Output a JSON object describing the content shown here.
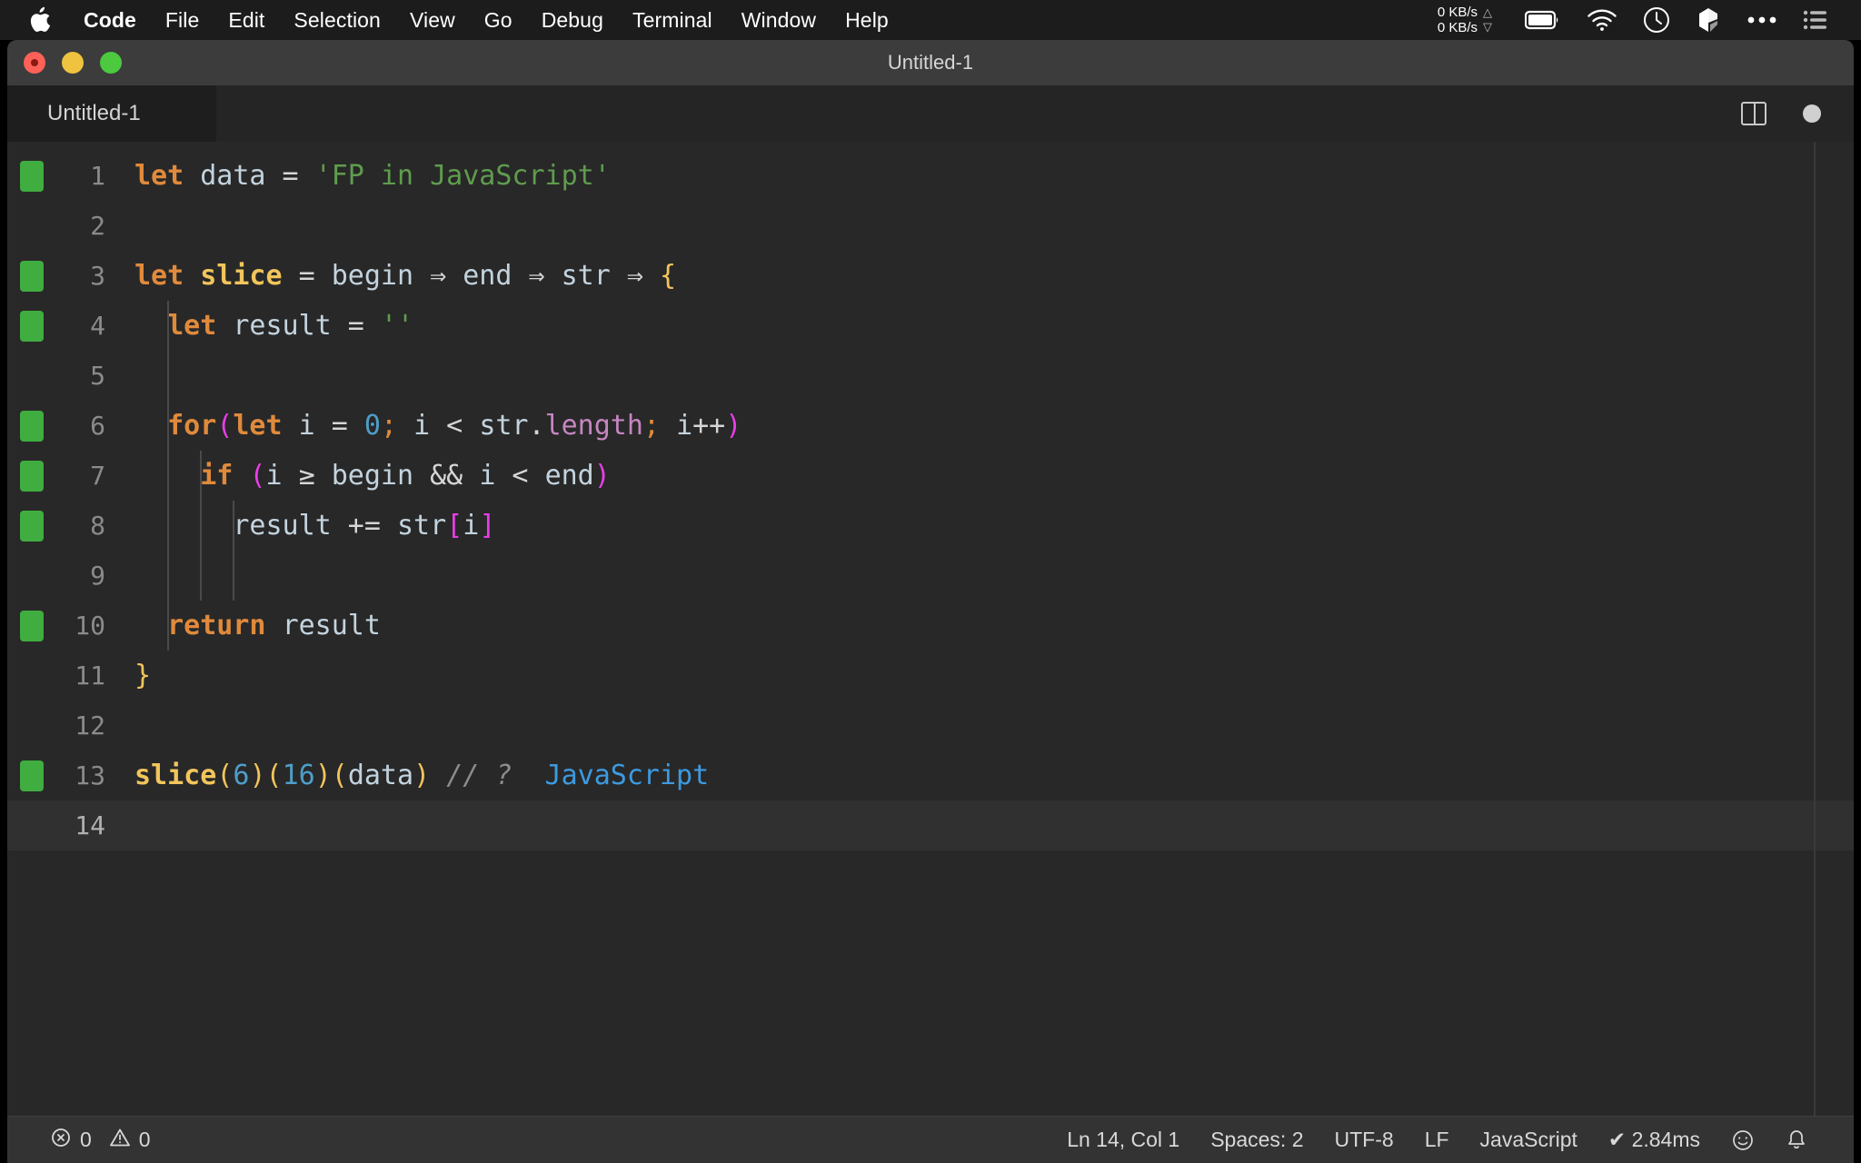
{
  "menubar": {
    "apple_icon": "apple-logo-icon",
    "items": [
      {
        "label": "Code",
        "bold": true
      },
      {
        "label": "File",
        "bold": false
      },
      {
        "label": "Edit",
        "bold": false
      },
      {
        "label": "Selection",
        "bold": false
      },
      {
        "label": "View",
        "bold": false
      },
      {
        "label": "Go",
        "bold": false
      },
      {
        "label": "Debug",
        "bold": false
      },
      {
        "label": "Terminal",
        "bold": false
      },
      {
        "label": "Window",
        "bold": false
      },
      {
        "label": "Help",
        "bold": false
      }
    ],
    "network": {
      "upload": "0 KB/s",
      "download": "0 KB/s",
      "up_arrow": "△",
      "down_arrow": "▽"
    },
    "tray_icons": [
      "battery-icon",
      "wifi-icon",
      "clock-icon",
      "dropbox-icon",
      "more-icon",
      "control-center-icon"
    ]
  },
  "window": {
    "title": "Untitled-1",
    "traffic_lights": [
      "close-button",
      "minimize-button",
      "maximize-button"
    ]
  },
  "tabbar": {
    "active_tab": "Untitled-1",
    "actions": [
      "split-editor-icon",
      "unsaved-dot-icon"
    ]
  },
  "editor": {
    "lines": [
      {
        "num": "1",
        "gutter": "added",
        "current": false,
        "indent": 0,
        "tokens": [
          {
            "t": "let",
            "c": "tok-key"
          },
          {
            "t": " ",
            "c": "tok-op"
          },
          {
            "t": "data",
            "c": "tok-var"
          },
          {
            "t": " = ",
            "c": "tok-op"
          },
          {
            "t": "'FP in JavaScript'",
            "c": "tok-str"
          }
        ]
      },
      {
        "num": "2",
        "gutter": "none",
        "current": false,
        "indent": 0,
        "tokens": []
      },
      {
        "num": "3",
        "gutter": "added",
        "current": false,
        "indent": 0,
        "tokens": [
          {
            "t": "let",
            "c": "tok-key"
          },
          {
            "t": " ",
            "c": "tok-op"
          },
          {
            "t": "slice",
            "c": "tok-fn"
          },
          {
            "t": " = ",
            "c": "tok-op"
          },
          {
            "t": "begin",
            "c": "tok-var"
          },
          {
            "t": " ⇒ ",
            "c": "tok-op"
          },
          {
            "t": "end",
            "c": "tok-var"
          },
          {
            "t": " ⇒ ",
            "c": "tok-op"
          },
          {
            "t": "str",
            "c": "tok-var"
          },
          {
            "t": " ⇒ ",
            "c": "tok-op"
          },
          {
            "t": "{",
            "c": "tok-brace"
          }
        ]
      },
      {
        "num": "4",
        "gutter": "added",
        "current": false,
        "indent": 1,
        "tokens": [
          {
            "t": "  ",
            "c": "tok-op"
          },
          {
            "t": "let",
            "c": "tok-key"
          },
          {
            "t": " ",
            "c": "tok-op"
          },
          {
            "t": "result",
            "c": "tok-var"
          },
          {
            "t": " = ",
            "c": "tok-op"
          },
          {
            "t": "''",
            "c": "tok-str"
          }
        ]
      },
      {
        "num": "5",
        "gutter": "none",
        "current": false,
        "indent": 1,
        "tokens": []
      },
      {
        "num": "6",
        "gutter": "added",
        "current": false,
        "indent": 1,
        "tokens": [
          {
            "t": "  ",
            "c": "tok-op"
          },
          {
            "t": "for",
            "c": "tok-key"
          },
          {
            "t": "(",
            "c": "tok-paren"
          },
          {
            "t": "let",
            "c": "tok-key"
          },
          {
            "t": " ",
            "c": "tok-op"
          },
          {
            "t": "i",
            "c": "tok-var"
          },
          {
            "t": " = ",
            "c": "tok-op"
          },
          {
            "t": "0",
            "c": "tok-num"
          },
          {
            "t": ";",
            "c": "tok-semi"
          },
          {
            "t": " ",
            "c": "tok-op"
          },
          {
            "t": "i",
            "c": "tok-var"
          },
          {
            "t": " < ",
            "c": "tok-op"
          },
          {
            "t": "str",
            "c": "tok-var"
          },
          {
            "t": ".",
            "c": "tok-op"
          },
          {
            "t": "length",
            "c": "tok-prop"
          },
          {
            "t": ";",
            "c": "tok-semi"
          },
          {
            "t": " ",
            "c": "tok-op"
          },
          {
            "t": "i",
            "c": "tok-var"
          },
          {
            "t": "++",
            "c": "tok-op"
          },
          {
            "t": ")",
            "c": "tok-paren"
          }
        ]
      },
      {
        "num": "7",
        "gutter": "added",
        "current": false,
        "indent": 2,
        "tokens": [
          {
            "t": "    ",
            "c": "tok-op"
          },
          {
            "t": "if",
            "c": "tok-key"
          },
          {
            "t": " ",
            "c": "tok-op"
          },
          {
            "t": "(",
            "c": "tok-paren"
          },
          {
            "t": "i",
            "c": "tok-var"
          },
          {
            "t": " ≥ ",
            "c": "tok-op"
          },
          {
            "t": "begin",
            "c": "tok-var"
          },
          {
            "t": " && ",
            "c": "tok-op"
          },
          {
            "t": "i",
            "c": "tok-var"
          },
          {
            "t": " < ",
            "c": "tok-op"
          },
          {
            "t": "end",
            "c": "tok-var"
          },
          {
            "t": ")",
            "c": "tok-paren"
          }
        ]
      },
      {
        "num": "8",
        "gutter": "added",
        "current": false,
        "indent": 3,
        "tokens": [
          {
            "t": "      ",
            "c": "tok-op"
          },
          {
            "t": "result",
            "c": "tok-var"
          },
          {
            "t": " += ",
            "c": "tok-op"
          },
          {
            "t": "str",
            "c": "tok-var"
          },
          {
            "t": "[",
            "c": "tok-bracket"
          },
          {
            "t": "i",
            "c": "tok-var"
          },
          {
            "t": "]",
            "c": "tok-bracket"
          }
        ]
      },
      {
        "num": "9",
        "gutter": "none",
        "current": false,
        "indent": 2,
        "tokens": []
      },
      {
        "num": "10",
        "gutter": "added",
        "current": false,
        "indent": 1,
        "tokens": [
          {
            "t": "  ",
            "c": "tok-op"
          },
          {
            "t": "return",
            "c": "tok-key"
          },
          {
            "t": " ",
            "c": "tok-op"
          },
          {
            "t": "result",
            "c": "tok-var"
          }
        ]
      },
      {
        "num": "11",
        "gutter": "none",
        "current": false,
        "indent": 0,
        "tokens": [
          {
            "t": "}",
            "c": "tok-brace"
          }
        ]
      },
      {
        "num": "12",
        "gutter": "none",
        "current": false,
        "indent": 0,
        "tokens": []
      },
      {
        "num": "13",
        "gutter": "added",
        "current": false,
        "indent": 0,
        "tokens": [
          {
            "t": "slice",
            "c": "tok-fn"
          },
          {
            "t": "(",
            "c": "tok-brace"
          },
          {
            "t": "6",
            "c": "tok-num"
          },
          {
            "t": ")",
            "c": "tok-brace"
          },
          {
            "t": "(",
            "c": "tok-brace"
          },
          {
            "t": "16",
            "c": "tok-num"
          },
          {
            "t": ")",
            "c": "tok-brace"
          },
          {
            "t": "(",
            "c": "tok-brace"
          },
          {
            "t": "data",
            "c": "tok-var"
          },
          {
            "t": ")",
            "c": "tok-brace"
          },
          {
            "t": " ",
            "c": "tok-op"
          },
          {
            "t": "// ? ",
            "c": "tok-comment"
          },
          {
            "t": " JavaScript",
            "c": "tok-comment-val"
          }
        ]
      },
      {
        "num": "14",
        "gutter": "none",
        "current": true,
        "indent": 0,
        "tokens": []
      }
    ]
  },
  "statusbar": {
    "errors": {
      "icon": "error-circle-icon",
      "count": "0"
    },
    "warnings": {
      "icon": "warning-triangle-icon",
      "count": "0"
    },
    "cursor_position": "Ln 14, Col 1",
    "indentation": "Spaces: 2",
    "encoding": "UTF-8",
    "eol": "LF",
    "language": "JavaScript",
    "timing": "✔ 2.84ms",
    "feedback_icon": "smiley-icon",
    "notifications_icon": "bell-icon"
  },
  "colors": {
    "menubar_bg": "#1c1c1c",
    "titlebar_bg": "#3c3c3c",
    "tabbar_bg": "#252526",
    "editor_bg": "#282828",
    "statusbar_bg": "#333333",
    "git_added": "#3fad3f",
    "string_green": "#5f9c4e",
    "keyword_orange": "#e08a3c",
    "function_yellow": "#f2c55c",
    "number_blue": "#4d9ec9",
    "property_pink": "#c586c0",
    "paren_magenta": "#e83ee8"
  }
}
